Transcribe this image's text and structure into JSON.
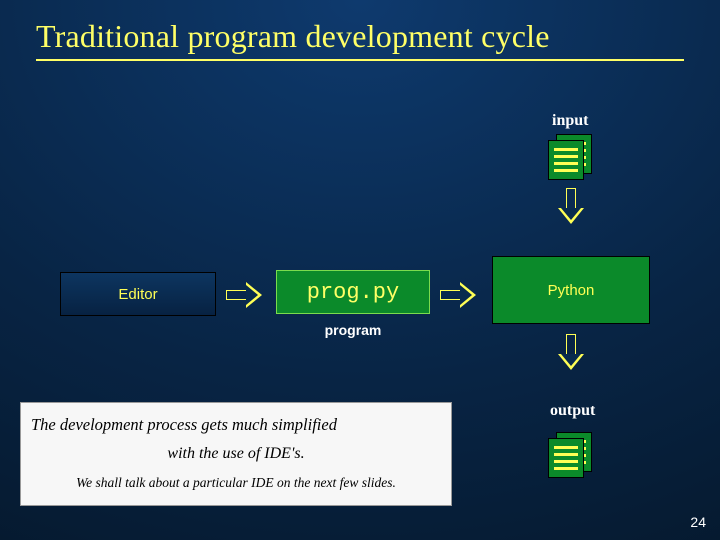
{
  "title": "Traditional program development cycle",
  "labels": {
    "input": "input",
    "output": "output",
    "program": "program"
  },
  "boxes": {
    "editor": "Editor",
    "prog": "prog.py",
    "python": "Python"
  },
  "callout": {
    "line1": "The development process gets much simplified",
    "line2": "with the use of IDE's.",
    "line3": "We shall talk about a particular IDE on the next few slides."
  },
  "slide_number": "24",
  "icons": {
    "doc_stack": "document-stack-icon",
    "arrow_down": "arrow-down-icon",
    "arrow_right": "arrow-right-icon"
  }
}
